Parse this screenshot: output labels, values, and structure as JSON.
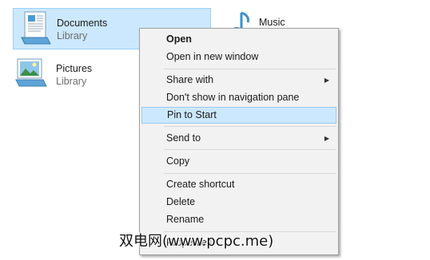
{
  "libraries": [
    {
      "title": "Documents",
      "subtitle": "Library",
      "icon": "documents-library-icon"
    },
    {
      "title": "Music",
      "subtitle": "",
      "icon": "music-library-icon"
    },
    {
      "title": "Pictures",
      "subtitle": "Library",
      "icon": "pictures-library-icon"
    }
  ],
  "context_menu": {
    "items": [
      {
        "label": "Open",
        "bold": true
      },
      {
        "label": "Open in new window"
      },
      {
        "label": "Share with",
        "submenu": true
      },
      {
        "label": "Don't show in navigation pane"
      },
      {
        "label": "Pin to Start",
        "highlighted": true
      },
      {
        "label": "Send to",
        "submenu": true
      },
      {
        "label": "Copy"
      },
      {
        "label": "Create shortcut"
      },
      {
        "label": "Delete"
      },
      {
        "label": "Rename"
      },
      {
        "label": "Properties",
        "partially_hidden": true
      }
    ],
    "submenu_glyph": "▶"
  },
  "watermark": {
    "text": "双电网(www.pcpc.me)"
  },
  "colors": {
    "selection_fill": "#cce8ff",
    "selection_border": "#99d1ff",
    "menu_background": "#f2f2f2"
  }
}
